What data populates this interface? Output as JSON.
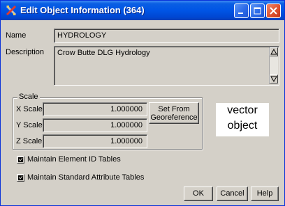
{
  "window": {
    "title": "Edit Object Information (364)",
    "icon": "tools-icon"
  },
  "form": {
    "name_label": "Name",
    "name_value": "HYDROLOGY",
    "description_label": "Description",
    "description_value": "Crow Butte DLG Hydrology"
  },
  "scale": {
    "group_label": "Scale",
    "x_label": "X Scale",
    "x_value": "1.000000",
    "y_label": "Y Scale",
    "y_value": "1.000000",
    "z_label": "Z Scale",
    "z_value": "1.000000",
    "set_from_label_1": "Set From",
    "set_from_label_2": "Georeference"
  },
  "note": {
    "line1": "vector",
    "line2": "object"
  },
  "options": {
    "maintain_element_id": {
      "label": "Maintain Element ID Tables",
      "checked": true
    },
    "maintain_std_attr": {
      "label": "Maintain Standard Attribute Tables",
      "checked": true
    }
  },
  "buttons": {
    "ok": "OK",
    "cancel": "Cancel",
    "help": "Help"
  }
}
